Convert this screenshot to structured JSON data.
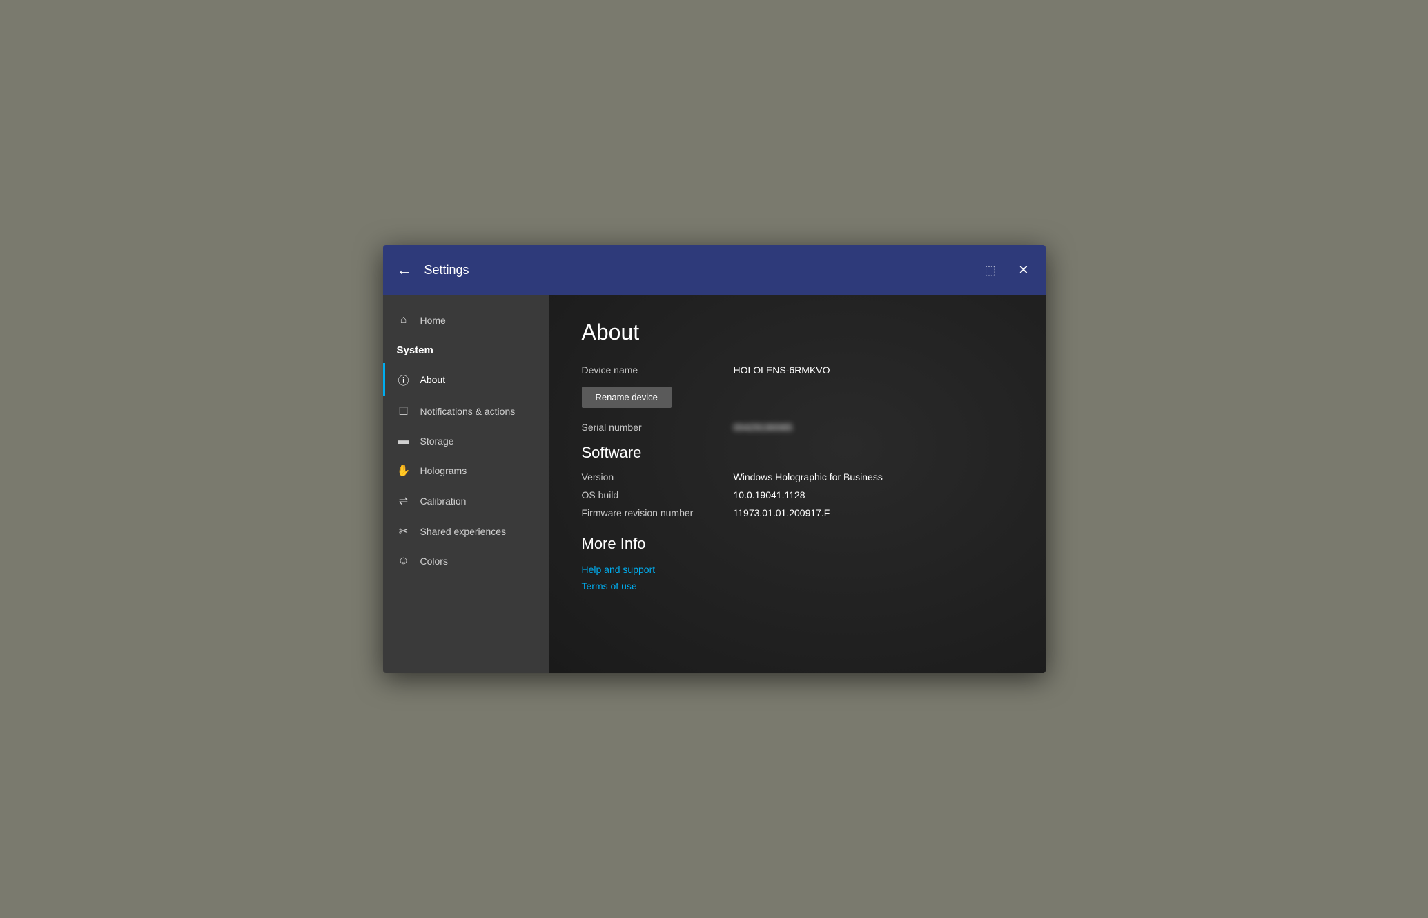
{
  "titlebar": {
    "title": "Settings",
    "back_label": "←",
    "window_icon": "⬚",
    "close_icon": "✕"
  },
  "sidebar": {
    "home_label": "Home",
    "system_label": "System",
    "items": [
      {
        "id": "about",
        "label": "About",
        "icon": "ⓘ",
        "active": true
      },
      {
        "id": "notifications",
        "label": "Notifications & actions",
        "icon": "🗔",
        "active": false
      },
      {
        "id": "storage",
        "label": "Storage",
        "icon": "▬",
        "active": false
      },
      {
        "id": "holograms",
        "label": "Holograms",
        "icon": "✋",
        "active": false
      },
      {
        "id": "calibration",
        "label": "Calibration",
        "icon": "⇌",
        "active": false
      },
      {
        "id": "shared",
        "label": "Shared experiences",
        "icon": "✂",
        "active": false
      },
      {
        "id": "colors",
        "label": "Colors",
        "icon": "☺",
        "active": false
      }
    ]
  },
  "content": {
    "page_title": "About",
    "device_name_label": "Device name",
    "device_name_value": "HOLOLENS-6RMKVO",
    "rename_btn_label": "Rename device",
    "serial_number_label": "Serial number",
    "serial_number_value": "00429190065",
    "software_heading": "Software",
    "version_label": "Version",
    "version_value": "Windows Holographic for Business",
    "os_build_label": "OS build",
    "os_build_value": "10.0.19041.1128",
    "firmware_label": "Firmware revision number",
    "firmware_value": "11973.01.01.200917.F",
    "more_info_heading": "More Info",
    "links": [
      {
        "id": "help",
        "label": "Help and support"
      },
      {
        "id": "terms",
        "label": "Terms of use"
      }
    ]
  }
}
